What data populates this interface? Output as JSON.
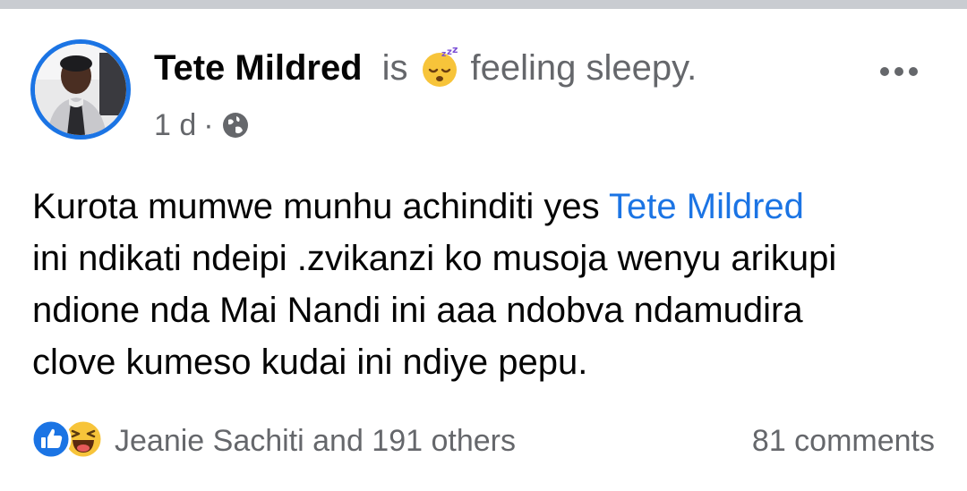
{
  "post": {
    "author": "Tete Mildred",
    "is_word": "is",
    "feeling_icon": "sleepy-face-emoji",
    "feeling_text": "feeling sleepy.",
    "time": "1 d",
    "meta_separator": "·",
    "audience_icon": "globe-icon",
    "more_icon": "more-options-icon",
    "body": {
      "line1_text": "Kurota mumwe munhu achinditi yes ",
      "line1_mention": "Tete Mildred",
      "line2": "ini ndikati ndeipi .zvikanzi ko musoja wenyu arikupi",
      "line3": "ndione nda Mai Nandi ini aaa ndobva ndamudira",
      "line4": "clove kumeso kudai ini ndiye pepu."
    }
  },
  "reactions": {
    "icons": [
      "like-icon",
      "haha-icon"
    ],
    "names_text": "Jeanie Sachiti and 191 others",
    "comments_text": "81 comments"
  },
  "colors": {
    "accent": "#1b74e4",
    "secondary_text": "#65676b",
    "primary_text": "#050505",
    "divider": "#c9ccd1"
  }
}
